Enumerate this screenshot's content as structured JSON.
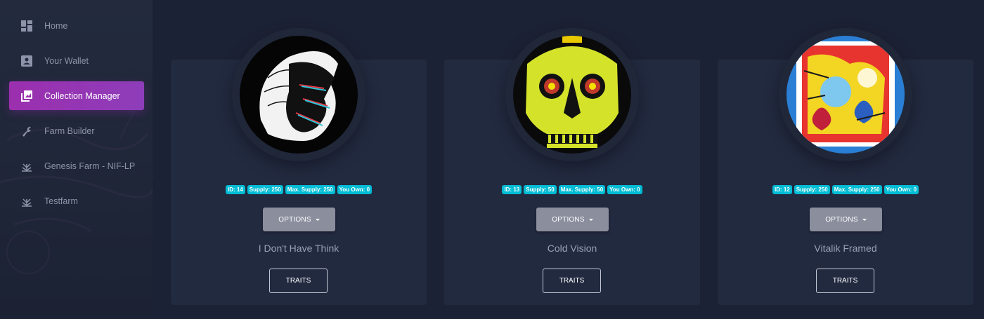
{
  "sidebar": {
    "items": [
      {
        "label": "Home",
        "icon": "dashboard-icon",
        "active": false
      },
      {
        "label": "Your Wallet",
        "icon": "wallet-icon",
        "active": false
      },
      {
        "label": "Collection Manager",
        "icon": "collections-icon",
        "active": true
      },
      {
        "label": "Farm Builder",
        "icon": "wrench-icon",
        "active": false
      },
      {
        "label": "Genesis Farm - NIF-LP",
        "icon": "plant-icon",
        "active": false
      },
      {
        "label": "Testfarm",
        "icon": "plant-icon",
        "active": false
      }
    ]
  },
  "cards": [
    {
      "title": "I Don't Have Think",
      "badges": [
        "ID: 14",
        "Supply: 250",
        "Max. Supply: 250",
        "You Own: 0"
      ],
      "options_label": "OPTIONS",
      "traits_label": "TRAITS"
    },
    {
      "title": "Cold Vision",
      "badges": [
        "ID: 13",
        "Supply: 50",
        "Max. Supply: 50",
        "You Own: 0"
      ],
      "options_label": "OPTIONS",
      "traits_label": "TRAITS"
    },
    {
      "title": "Vitalik Framed",
      "badges": [
        "ID: 12",
        "Supply: 250",
        "Max. Supply: 250",
        "You Own: 0"
      ],
      "options_label": "OPTIONS",
      "traits_label": "TRAITS"
    }
  ],
  "colors": {
    "accent": "#9b2fae",
    "badge": "#00bcd4",
    "background": "#1c2235",
    "card": "#222a40"
  }
}
